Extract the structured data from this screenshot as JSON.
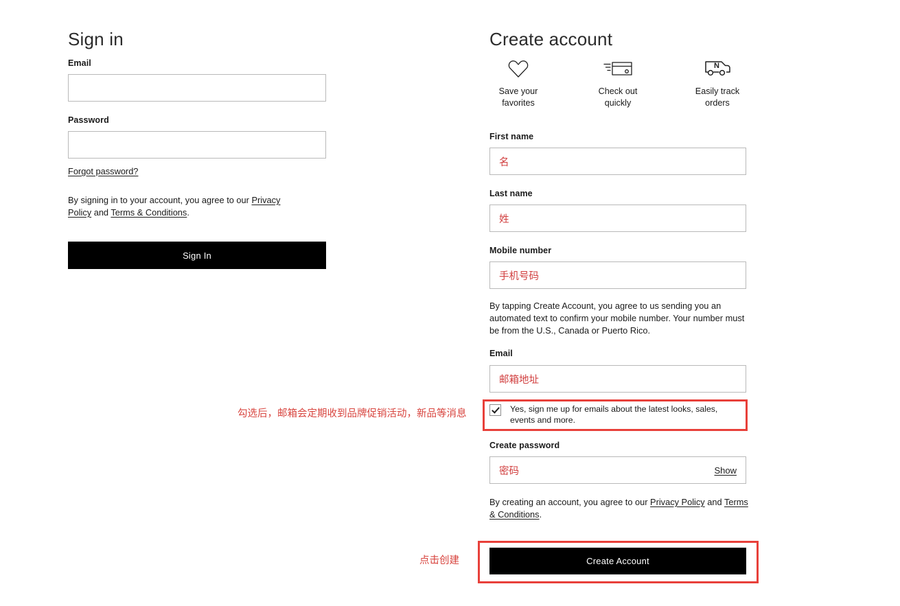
{
  "signin": {
    "title": "Sign in",
    "email_label": "Email",
    "email_value": "",
    "password_label": "Password",
    "password_value": "",
    "forgot_link": "Forgot password?",
    "legal_prefix": "By signing in to your account, you agree to our ",
    "legal_link1": "Privacy Policy",
    "legal_mid": " and ",
    "legal_link2": "Terms & Conditions",
    "legal_suffix": ".",
    "submit_label": "Sign In"
  },
  "create": {
    "title": "Create account",
    "benefits": [
      {
        "icon": "heart-icon",
        "line1": "Save your",
        "line2": "favorites"
      },
      {
        "icon": "credit-card-icon",
        "line1": "Check out",
        "line2": "quickly"
      },
      {
        "icon": "delivery-truck-icon",
        "line1": "Easily track",
        "line2": "orders"
      }
    ],
    "first_name_label": "First name",
    "first_name_value": "名",
    "last_name_label": "Last name",
    "last_name_value": "姓",
    "mobile_label": "Mobile number",
    "mobile_value": "手机号码",
    "mobile_disclaimer": "By tapping Create Account, you agree to us sending you an automated text to confirm your mobile number. Your number must be from the U.S., Canada or Puerto Rico.",
    "email_label": "Email",
    "email_value": "邮箱地址",
    "optin_checked": true,
    "optin_text": "Yes, sign me up for emails about the latest looks, sales, events and more.",
    "password_label": "Create password",
    "password_value": "密码",
    "show_label": "Show",
    "legal_prefix": "By creating an account, you agree to our ",
    "legal_link1": "Privacy Policy",
    "legal_mid": " and ",
    "legal_link2": "Terms & Conditions",
    "legal_suffix": ".",
    "submit_label": "Create Account"
  },
  "annotations": {
    "optin_note": "勾选后，邮箱会定期收到品牌促销活动，新品等消息",
    "create_note": "点击创建",
    "highlight_color": "#e8403a"
  }
}
